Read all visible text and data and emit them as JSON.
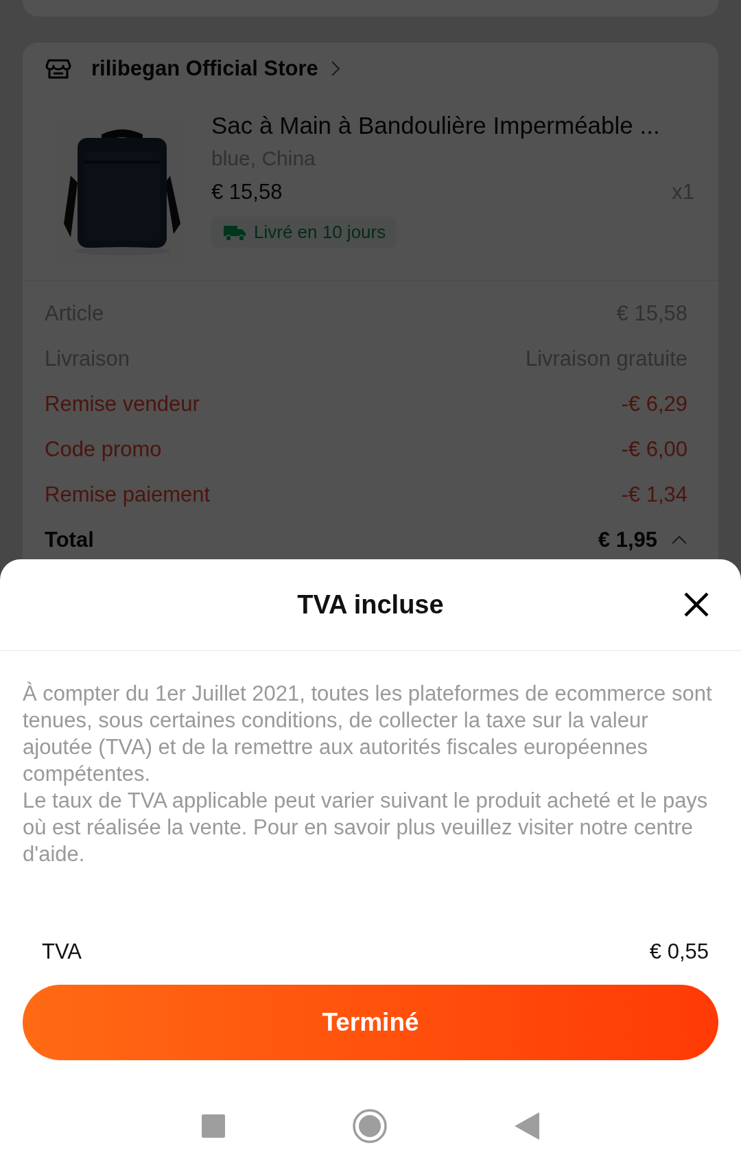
{
  "order": {
    "store": {
      "name": "rilibegan Official Store"
    },
    "product": {
      "kind": "picture",
      "title": "Sac à Main à Bandoulière Imperméable ...",
      "variant": "blue, China",
      "price": "€ 15,58",
      "quantity": "x1",
      "delivery": "Livré en 10 jours"
    },
    "summary": [
      {
        "kind": "normal",
        "label": "Article",
        "value": "€ 15,58"
      },
      {
        "kind": "normal",
        "label": "Livraison",
        "value": "Livraison gratuite"
      },
      {
        "kind": "discount",
        "label": "Remise vendeur",
        "value": "-€ 6,29"
      },
      {
        "kind": "discount",
        "label": "Code promo",
        "value": "-€ 6,00"
      },
      {
        "kind": "discount",
        "label": "Remise paiement",
        "value": "-€ 1,34"
      },
      {
        "kind": "total",
        "label": "Total",
        "value": "€ 1,95",
        "expanded": true
      }
    ]
  },
  "sheet": {
    "title": "TVA incluse",
    "paragraphs": [
      "À compter du 1er Juillet 2021, toutes les plateformes de ecommerce sont tenues, sous certaines conditions, de collecter la taxe sur la valeur ajoutée (TVA) et de la remettre aux autorités fiscales européennes compétentes.",
      "Le taux de TVA applicable peut varier suivant le produit acheté et le pays où est réalisée la vente. Pour en savoir plus veuillez visiter notre centre d'aide."
    ],
    "tax": {
      "label": "TVA",
      "value": "€ 0,55"
    },
    "button": "Terminé"
  }
}
